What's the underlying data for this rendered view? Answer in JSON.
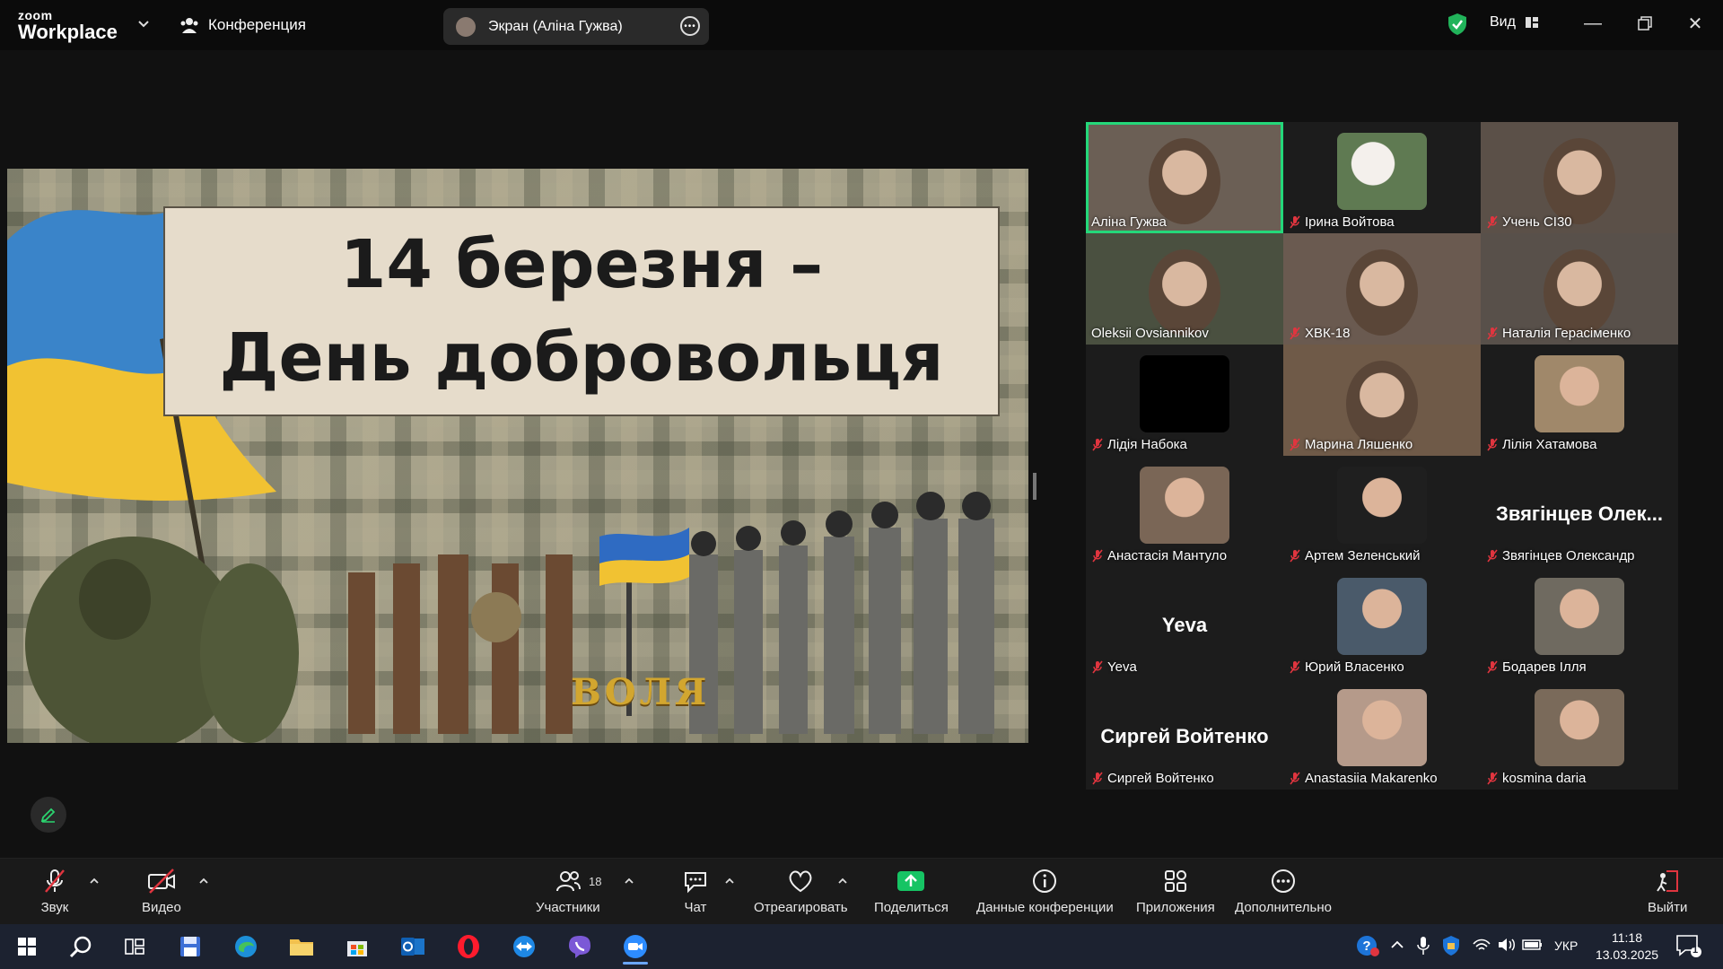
{
  "app": {
    "logo_small": "zoom",
    "logo_big": "Workplace",
    "conference_tab": "Конференция",
    "screen_share_label": "Экран (Аліна Гужва)",
    "view_label": "Вид",
    "colors": {
      "accent_green": "#24d87a",
      "share_green": "#16c464",
      "mute_red": "#e0353f",
      "exit_red": "#e0353f"
    }
  },
  "slide": {
    "title_line1": "14 березня –",
    "title_line2": "День добровольця",
    "wordmark": "ВОЛЯ"
  },
  "participants": [
    {
      "name": "Аліна Гужва",
      "muted": false,
      "video": true,
      "active": true
    },
    {
      "name": "Ірина Войтова",
      "muted": true,
      "video": false,
      "avatar": "flowers"
    },
    {
      "name": "Учень СІ30",
      "muted": true,
      "video": true
    },
    {
      "name": "Oleksii Ovsiannikov",
      "muted": false,
      "video": true
    },
    {
      "name": "ХВК-18",
      "muted": true,
      "video": true
    },
    {
      "name": "Наталія Герасіменко",
      "muted": true,
      "video": true
    },
    {
      "name": "Лідія Набока",
      "muted": true,
      "video": false,
      "avatar": "black"
    },
    {
      "name": "Марина Ляшенко",
      "muted": true,
      "video": true
    },
    {
      "name": "Лілія Хатамова",
      "muted": true,
      "video": false,
      "avatar": "photo"
    },
    {
      "name": "Анастасія Мантуло",
      "muted": true,
      "video": false,
      "avatar": "photo"
    },
    {
      "name": "Артем Зеленський",
      "muted": true,
      "video": false,
      "avatar": "dark-photo"
    },
    {
      "name": "Звягінцев Олександр",
      "muted": true,
      "video": false,
      "big_name": "Звягінцев Олек..."
    },
    {
      "name": "Yeva",
      "muted": true,
      "video": false,
      "big_name": "Yeva"
    },
    {
      "name": "Юрий Власенко",
      "muted": true,
      "video": false,
      "avatar": "photo"
    },
    {
      "name": "Бодарев Ілля",
      "muted": true,
      "video": false,
      "avatar": "photo"
    },
    {
      "name": "Сиргей Войтенко",
      "muted": true,
      "video": false,
      "big_name": "Сиргей Войтенко"
    },
    {
      "name": "Anastasiia Makarenko",
      "muted": true,
      "video": false,
      "avatar": "photo"
    },
    {
      "name": "kosmina daria",
      "muted": true,
      "video": false,
      "avatar": "photo"
    }
  ],
  "toolbar": {
    "audio": "Звук",
    "video": "Видео",
    "participants": "Участники",
    "participants_count": "18",
    "chat": "Чат",
    "react": "Отреагировать",
    "share": "Поделиться",
    "meeting_info": "Данные конференции",
    "apps": "Приложения",
    "more": "Дополнительно",
    "leave": "Выйти"
  },
  "taskbar": {
    "lang": "УКР",
    "time": "11:18",
    "date": "13.03.2025",
    "notifications": "1"
  }
}
